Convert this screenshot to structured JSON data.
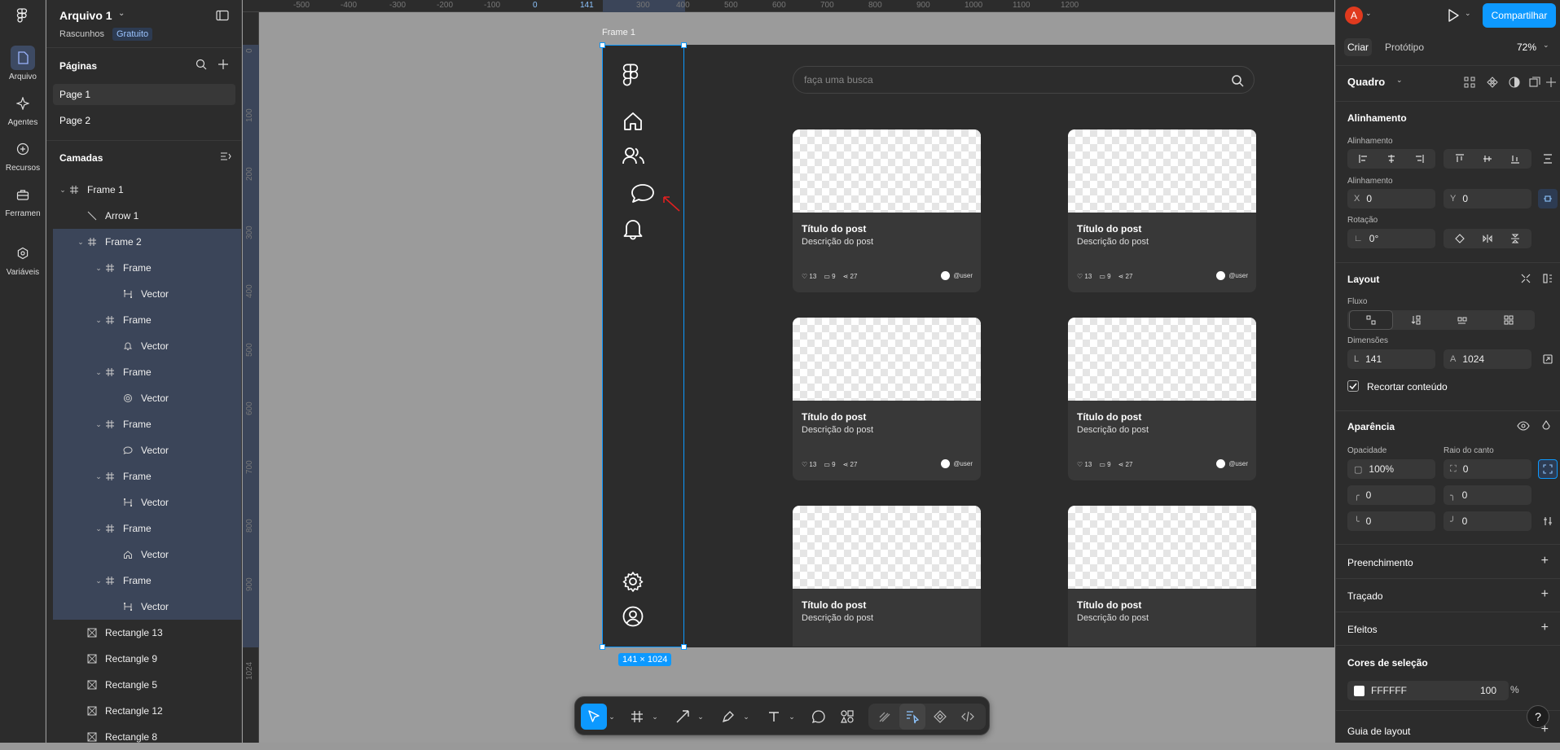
{
  "rail": [
    {
      "label": "Arquivo",
      "icon": "file-icon"
    },
    {
      "label": "Agentes",
      "icon": "sparkle-icon"
    },
    {
      "label": "Recursos",
      "icon": "plus-circle-icon"
    },
    {
      "label": "Ferramen",
      "icon": "toolbox-icon"
    },
    {
      "label": "Variáveis",
      "icon": "hexagon-icon"
    }
  ],
  "file": {
    "name": "Arquivo 1",
    "project": "Rascunhos",
    "plan": "Gratuito"
  },
  "pages": {
    "title": "Páginas",
    "items": [
      "Page 1",
      "Page 2"
    ]
  },
  "layers": {
    "title": "Camadas",
    "items": [
      {
        "label": "Frame 1",
        "icon": "frame-icon",
        "indent": 0,
        "chev": "⌄",
        "sel": false
      },
      {
        "label": "Arrow 1",
        "icon": "arrow-line-icon",
        "indent": 1,
        "chev": "",
        "sel": false
      },
      {
        "label": "Frame 2",
        "icon": "frame-icon",
        "indent": 1,
        "chev": "⌄",
        "sel": true,
        "bold": true
      },
      {
        "label": "Frame",
        "icon": "frame-icon",
        "indent": 2,
        "chev": "⌄",
        "sel": true
      },
      {
        "label": "Vector",
        "icon": "vector-icon",
        "indent": 3,
        "chev": "",
        "sel": true
      },
      {
        "label": "Frame",
        "icon": "frame-icon",
        "indent": 2,
        "chev": "⌄",
        "sel": true
      },
      {
        "label": "Vector",
        "icon": "bell-small-icon",
        "indent": 3,
        "chev": "",
        "sel": true
      },
      {
        "label": "Frame",
        "icon": "frame-icon",
        "indent": 2,
        "chev": "⌄",
        "sel": true
      },
      {
        "label": "Vector",
        "icon": "gear-small-icon",
        "indent": 3,
        "chev": "",
        "sel": true
      },
      {
        "label": "Frame",
        "icon": "frame-icon",
        "indent": 2,
        "chev": "⌄",
        "sel": true
      },
      {
        "label": "Vector",
        "icon": "chat-small-icon",
        "indent": 3,
        "chev": "",
        "sel": true
      },
      {
        "label": "Frame",
        "icon": "frame-icon",
        "indent": 2,
        "chev": "⌄",
        "sel": true
      },
      {
        "label": "Vector",
        "icon": "vector-icon",
        "indent": 3,
        "chev": "",
        "sel": true
      },
      {
        "label": "Frame",
        "icon": "frame-icon",
        "indent": 2,
        "chev": "⌄",
        "sel": true
      },
      {
        "label": "Vector",
        "icon": "home-small-icon",
        "indent": 3,
        "chev": "",
        "sel": true
      },
      {
        "label": "Frame",
        "icon": "frame-icon",
        "indent": 2,
        "chev": "⌄",
        "sel": true
      },
      {
        "label": "Vector",
        "icon": "vector-icon",
        "indent": 3,
        "chev": "",
        "sel": true
      },
      {
        "label": "Rectangle 13",
        "icon": "image-icon",
        "indent": 1,
        "chev": "",
        "sel": false
      },
      {
        "label": "Rectangle 9",
        "icon": "image-icon",
        "indent": 1,
        "chev": "",
        "sel": false
      },
      {
        "label": "Rectangle 5",
        "icon": "image-icon",
        "indent": 1,
        "chev": "",
        "sel": false
      },
      {
        "label": "Rectangle 12",
        "icon": "image-icon",
        "indent": 1,
        "chev": "",
        "sel": false
      },
      {
        "label": "Rectangle 8",
        "icon": "image-icon",
        "indent": 1,
        "chev": "",
        "sel": false
      }
    ]
  },
  "ruler": {
    "top": [
      "-500",
      "-400",
      "-300",
      "-200",
      "-100",
      "0",
      "141",
      "300",
      "400",
      "500",
      "600",
      "700",
      "800",
      "900",
      "1000",
      "1100",
      "1200"
    ],
    "left": [
      "0",
      "100",
      "200",
      "300",
      "400",
      "500",
      "600",
      "700",
      "800",
      "900",
      "1024"
    ]
  },
  "canvas": {
    "frame_label": "Frame 1",
    "size_badge": "141 × 1024",
    "search_placeholder": "faça uma busca"
  },
  "cards": [
    {
      "title": "Título do post",
      "desc": "Descrição do post",
      "likes": "13",
      "comments": "9",
      "shares": "27",
      "user": "@user"
    },
    {
      "title": "Título do post",
      "desc": "Descrição do post",
      "likes": "13",
      "comments": "9",
      "shares": "27",
      "user": "@user"
    },
    {
      "title": "Título do post",
      "desc": "Descrição do post",
      "likes": "13",
      "comments": "9",
      "shares": "27",
      "user": "@user"
    },
    {
      "title": "Título do post",
      "desc": "Descrição do post",
      "likes": "13",
      "comments": "9",
      "shares": "27",
      "user": "@user"
    },
    {
      "title": "Título do post",
      "desc": "Descrição do post"
    },
    {
      "title": "Título do post",
      "desc": "Descrição do post"
    }
  ],
  "header": {
    "avatar": "A",
    "share": "Compartilhar",
    "zoom": "72%",
    "tabs": [
      "Criar",
      "Protótipo"
    ]
  },
  "props": {
    "frame_type": "Quadro",
    "align_title": "Alinhamento",
    "align_label": "Alinhamento",
    "pos_label": "Alinhamento",
    "x": "0",
    "y": "0",
    "rot_label": "Rotação",
    "rot": "0°",
    "layout_title": "Layout",
    "flow_label": "Fluxo",
    "dims_label": "Dimensões",
    "w": "141",
    "h": "1024",
    "clip": "Recortar conteúdo",
    "appear_title": "Aparência",
    "opacity_label": "Opacidade",
    "radius_label": "Raio do canto",
    "opacity": "100%",
    "radius": "0",
    "r1": "0",
    "r2": "0",
    "r3": "0",
    "r4": "0",
    "fill": "Preenchimento",
    "stroke": "Traçado",
    "effects": "Efeitos",
    "sel_colors": "Cores de seleção",
    "color_hex": "FFFFFF",
    "color_opacity": "100",
    "pct": "%",
    "layout_guide": "Guia de layout",
    "help": "?"
  },
  "colors": {
    "accent": "#0d99ff",
    "selection": "#3b4559",
    "annotation_arrow": "#e02020"
  }
}
